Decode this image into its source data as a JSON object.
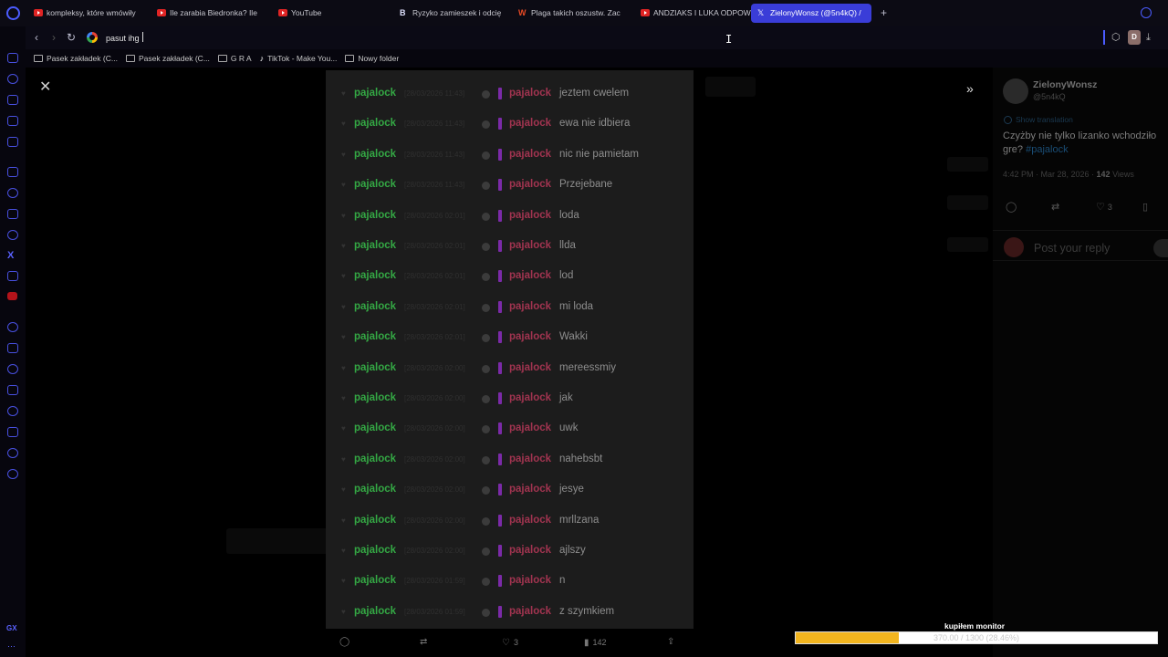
{
  "tabs": [
    {
      "label": "kompleksy, które wmówiły",
      "favicon": "youtube-icon"
    },
    {
      "label": "Ile zarabia Biedronka? Ile",
      "favicon": "youtube-icon"
    },
    {
      "label": "YouTube",
      "favicon": "youtube-icon"
    },
    {
      "label": "Ryzyko zamieszek i odcię",
      "favicon": "b-icon"
    },
    {
      "label": "Plaga takich oszustw. Zac",
      "favicon": "wp-icon"
    },
    {
      "label": "ANDZIAKS I LUKA ODPOW",
      "favicon": "youtube-icon"
    },
    {
      "label": "ZielonyWonsz (@5n4kQ) /",
      "favicon": "x-icon",
      "active": true
    }
  ],
  "address_bar": {
    "value": "pasut ihg"
  },
  "bookmarks": [
    {
      "label": "Pasek zakładek (C...",
      "icon": "folder-icon"
    },
    {
      "label": "Pasek zakładek (C...",
      "icon": "folder-icon"
    },
    {
      "label": "G R A",
      "icon": "folder-icon"
    },
    {
      "label": "TikTok - Make You...",
      "icon": "tiktok-icon"
    },
    {
      "label": "Nowy folder",
      "icon": "folder-icon"
    }
  ],
  "chat": [
    {
      "user": "pajalock",
      "timestamp": "[28/03/2026 11:43]",
      "target": "pajalock",
      "message": "jeztem cwelem"
    },
    {
      "user": "pajalock",
      "timestamp": "[28/03/2026 11:43]",
      "target": "pajalock",
      "message": "ewa nie idbiera"
    },
    {
      "user": "pajalock",
      "timestamp": "[28/03/2026 11:43]",
      "target": "pajalock",
      "message": "nic nie pamietam"
    },
    {
      "user": "pajalock",
      "timestamp": "[28/03/2026 11:43]",
      "target": "pajalock",
      "message": "Przejebane"
    },
    {
      "user": "pajalock",
      "timestamp": "[28/03/2026 02:01]",
      "target": "pajalock",
      "message": "loda"
    },
    {
      "user": "pajalock",
      "timestamp": "[28/03/2026 02:01]",
      "target": "pajalock",
      "message": "llda"
    },
    {
      "user": "pajalock",
      "timestamp": "[28/03/2026 02:01]",
      "target": "pajalock",
      "message": "lod"
    },
    {
      "user": "pajalock",
      "timestamp": "[28/03/2026 02:01]",
      "target": "pajalock",
      "message": "mi loda"
    },
    {
      "user": "pajalock",
      "timestamp": "[28/03/2026 02:01]",
      "target": "pajalock",
      "message": "Wakki"
    },
    {
      "user": "pajalock",
      "timestamp": "[28/03/2026 02:00]",
      "target": "pajalock",
      "message": "mereessmiy"
    },
    {
      "user": "pajalock",
      "timestamp": "[28/03/2026 02:00]",
      "target": "pajalock",
      "message": "jak"
    },
    {
      "user": "pajalock",
      "timestamp": "[28/03/2026 02:00]",
      "target": "pajalock",
      "message": "uwk"
    },
    {
      "user": "pajalock",
      "timestamp": "[28/03/2026 02:00]",
      "target": "pajalock",
      "message": "nahebsbt"
    },
    {
      "user": "pajalock",
      "timestamp": "[28/03/2026 02:00]",
      "target": "pajalock",
      "message": "jesye"
    },
    {
      "user": "pajalock",
      "timestamp": "[28/03/2026 02:00]",
      "target": "pajalock",
      "message": "mrllzana"
    },
    {
      "user": "pajalock",
      "timestamp": "[28/03/2026 02:00]",
      "target": "pajalock",
      "message": "ajlszy"
    },
    {
      "user": "pajalock",
      "timestamp": "[28/03/2026 01:59]",
      "target": "pajalock",
      "message": "n"
    },
    {
      "user": "pajalock",
      "timestamp": "[28/03/2026 01:59]",
      "target": "pajalock",
      "message": "z szymkiem"
    }
  ],
  "post_actions": {
    "likes": "3",
    "views": "142"
  },
  "tweet": {
    "display_name": "ZielonyWonsz",
    "handle": "@5n4kQ",
    "translate_label": "Show translation",
    "text": "Czyżby nie tylko lizanko wchodziło\ngre?",
    "hashtag": "#pajalock",
    "timestamp": "4:42 PM · Mar 28, 2026 · ",
    "views_count": "142",
    "views_label": " Views",
    "likes": "3",
    "reply_placeholder": "Post your reply"
  },
  "goal": {
    "label": "kupiłem monitor",
    "text": "370.00 / 1300 (28.46%)",
    "progress": 0.2846
  },
  "colors": {
    "accent": "#3a3dd8",
    "chat_user_green": "#34a844",
    "chat_user_red": "#a23450",
    "goal_fill": "#f2b51f"
  }
}
